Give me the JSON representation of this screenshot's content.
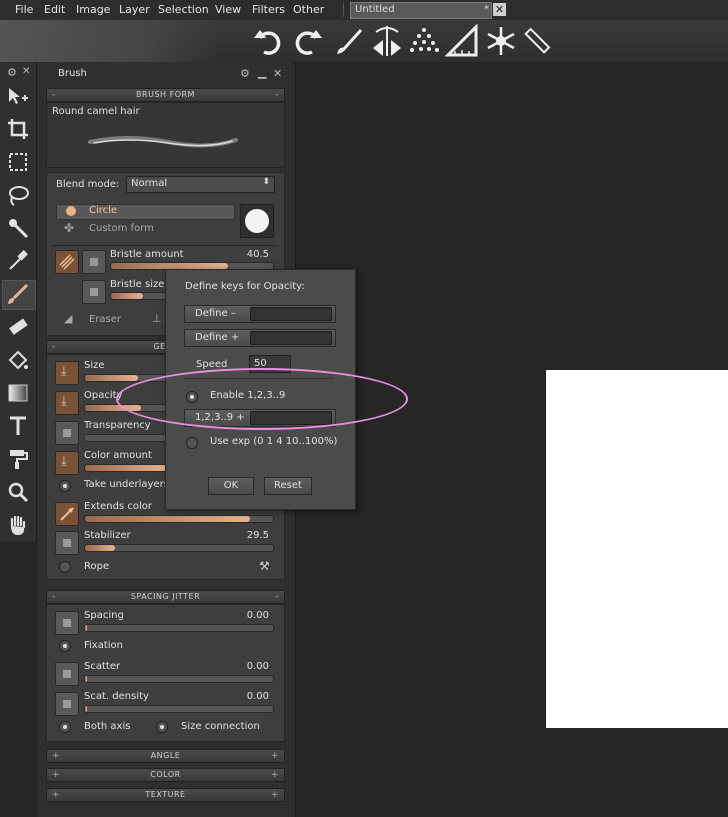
{
  "menubar": {
    "items": [
      "File",
      "Edit",
      "Image",
      "Layer",
      "Selection",
      "View",
      "Filters",
      "Other"
    ],
    "doc_tab": "Untitled",
    "doc_tab_star": "*"
  },
  "toolbar": {
    "icons": [
      "undo-icon",
      "redo-icon",
      "brush-preset-icon",
      "symmetry-icon",
      "scatter-icon",
      "ruler-triangle-icon",
      "snowflake-icon",
      "ruler-icon"
    ]
  },
  "tools": {
    "icons": [
      "move-icon",
      "crop-icon",
      "marquee-select-icon",
      "lasso-icon",
      "magic-wand-icon",
      "eyedropper-icon",
      "brush-icon",
      "eraser-icon",
      "fill-bucket-icon",
      "gradient-icon",
      "text-icon",
      "paint-roller-icon",
      "zoom-icon",
      "hand-icon"
    ]
  },
  "panel": {
    "title": "Brush",
    "brush_form_header": "BRUSH FORM",
    "brush_name": "Round camel hair",
    "blend_mode_label": "Blend mode:",
    "blend_mode_value": "Normal",
    "circle_label": "Circle",
    "custom_form_label": "Custom form",
    "bristle_amount_label": "Bristle amount",
    "bristle_amount_value": "40.5",
    "bristle_amount_fill": 0.72,
    "bristle_size_label": "Bristle size",
    "bristle_size_fill": 0.2,
    "eraser_label": "Eraser",
    "general_header": "GENE",
    "size_label": "Size",
    "size_fill": 0.28,
    "opacity_label": "Opacity",
    "transparency_label": "Transparency",
    "color_amount_label": "Color amount",
    "take_underlayers_label": "Take underlayers",
    "extends_color_label": "Extends color",
    "extends_color_fill": 0.88,
    "stabilizer_label": "Stabilizer",
    "stabilizer_value": "29.5",
    "stabilizer_fill": 0.16,
    "rope_label": "Rope",
    "spacing_jitter_header": "SPACING JITTER",
    "spacing_label": "Spacing",
    "spacing_value": "0.00",
    "fixation_label": "Fixation",
    "scatter_label": "Scatter",
    "scatter_value": "0.00",
    "scat_density_label": "Scat. density",
    "scat_density_value": "0.00",
    "both_axis_label": "Both axis",
    "size_connection_label": "Size connection",
    "angle_header": "ANGLE",
    "color_header": "COLOR",
    "texture_header": "TEXTURE",
    "plus": "+",
    "minus": "-"
  },
  "dialog": {
    "title": "Define keys for Opacity:",
    "define_minus": "Define –",
    "define_plus": "Define +",
    "speed_label": "Speed",
    "speed_value": "50",
    "enable_label": "Enable 1,2,3..9",
    "digits_label": "1,2,3..9 +",
    "use_exp_label": "Use exp (0 1 4 10..100%)",
    "ok": "OK",
    "reset": "Reset"
  },
  "colors": {
    "accent": "#e7b48e",
    "annotation": "#e98ee3"
  }
}
